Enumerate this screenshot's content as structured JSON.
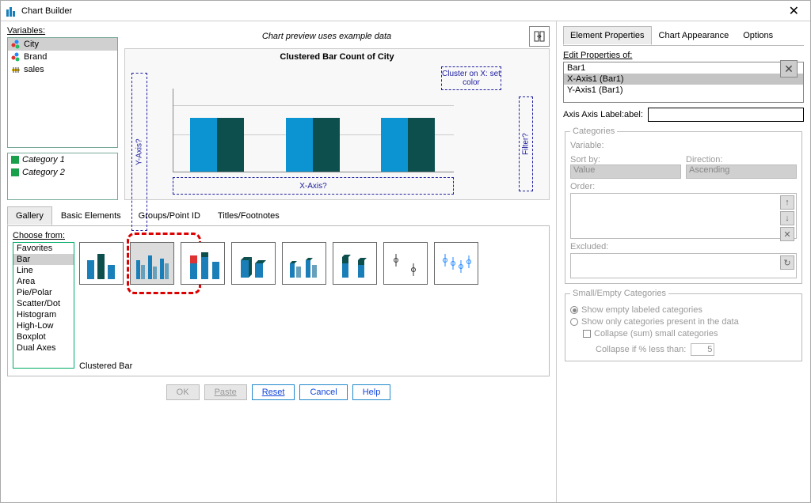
{
  "window": {
    "title": "Chart Builder",
    "close_glyph": "✕"
  },
  "variables_label": "Variables:",
  "variables": [
    {
      "name": "City",
      "type": "nominal",
      "selected": true
    },
    {
      "name": "Brand",
      "type": "nominal",
      "selected": false
    },
    {
      "name": "sales",
      "type": "scale",
      "selected": false
    }
  ],
  "categories": [
    {
      "label": "Category 1",
      "color": "#1aa04a"
    },
    {
      "label": "Category 2",
      "color": "#1aa04a"
    }
  ],
  "preview": {
    "caption": "Chart preview uses example data",
    "title": "Clustered Bar Count of City",
    "yaxis": "Y-Axis?",
    "xaxis": "X-Axis?",
    "cluster": "Cluster on X: set color",
    "filter": "Filter?"
  },
  "chart_data": {
    "type": "bar",
    "title": "Clustered Bar Count of City",
    "categories": [
      "",
      "",
      ""
    ],
    "series": [
      {
        "name": "Category 1",
        "values": [
          1,
          1,
          1
        ],
        "color": "#0c94d2"
      },
      {
        "name": "Category 2",
        "values": [
          1,
          1,
          1
        ],
        "color": "#0d4f4d"
      }
    ],
    "xlabel": "X-Axis?",
    "ylabel": "Y-Axis?"
  },
  "builder_tabs": [
    "Gallery",
    "Basic Elements",
    "Groups/Point ID",
    "Titles/Footnotes"
  ],
  "builder_active_tab": "Gallery",
  "gallery": {
    "choose_label": "Choose from:",
    "chart_types": [
      "Favorites",
      "Bar",
      "Line",
      "Area",
      "Pie/Polar",
      "Scatter/Dot",
      "Histogram",
      "High-Low",
      "Boxplot",
      "Dual Axes"
    ],
    "selected_type": "Bar",
    "selected_thumb_label": "Clustered Bar"
  },
  "buttons": {
    "ok": "OK",
    "paste": "Paste",
    "reset": "Reset",
    "cancel": "Cancel",
    "help": "Help"
  },
  "right": {
    "tabs": [
      "Element Properties",
      "Chart Appearance",
      "Options"
    ],
    "active_tab": "Element Properties",
    "edit_props_label": "Edit Properties of:",
    "prop_items": [
      "Bar1",
      "X-Axis1 (Bar1)",
      "Y-Axis1 (Bar1)"
    ],
    "prop_selected": "X-Axis1 (Bar1)",
    "axis_label": "Axis Label:",
    "axis_value": "",
    "categories_group": "Categories",
    "variable_label": "Variable:",
    "sort_by_label": "Sort by:",
    "sort_by_value": "Value",
    "direction_label": "Direction:",
    "direction_value": "Ascending",
    "order_label": "Order:",
    "excluded_label": "Excluded:",
    "small_group": "Small/Empty Categories",
    "radio1": "Show empty labeled categories",
    "radio2": "Show only categories present in the data",
    "cb_collapse": "Collapse (sum) small categories",
    "collapse_if": "Collapse if % less than:",
    "collapse_val": "5"
  }
}
